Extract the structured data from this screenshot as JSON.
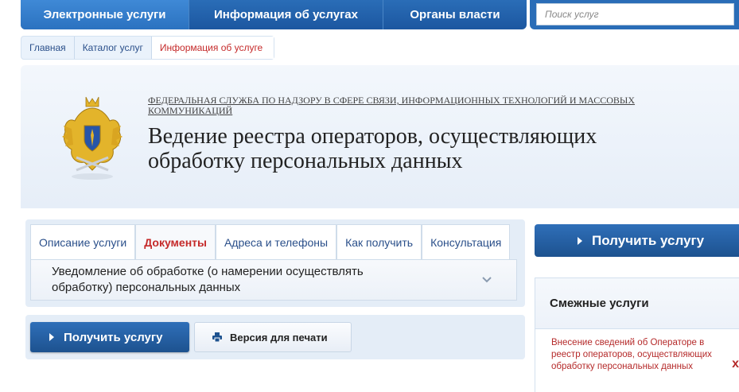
{
  "nav": {
    "items": [
      "Электронные услуги",
      "Информация об услугах",
      "Органы власти"
    ],
    "search_placeholder": "Поиск услуг"
  },
  "breadcrumbs": [
    "Главная",
    "Каталог услуг",
    "Информация об услуге"
  ],
  "header": {
    "agency": "Федеральная служба по надзору в сфере связи, информационных технологий и массовых коммуникаций",
    "title_line1": "Ведение реестра операторов, осуществляющих",
    "title_line2": "обработку персональных данных"
  },
  "tabs": [
    "Описание услуги",
    "Документы",
    "Адреса и телефоны",
    "Как получить",
    "Консультация"
  ],
  "accordion": {
    "line1": "Уведомление об обработке (о намерении осуществлять",
    "line2": "обработку) персональных данных"
  },
  "buttons": {
    "get_service": "Получить услугу",
    "print": "Версия для печати",
    "get_service_big": "Получить услугу"
  },
  "related": {
    "heading": "Смежные услуги",
    "item": "Внесение сведений об Операторе в реестр операторов, осуществляющих обработку персональных данных",
    "close": "x"
  },
  "colors": {
    "nav_blue": "#2a6db7",
    "accent_red": "#c52a2a",
    "button_blue": "#1d528f"
  }
}
